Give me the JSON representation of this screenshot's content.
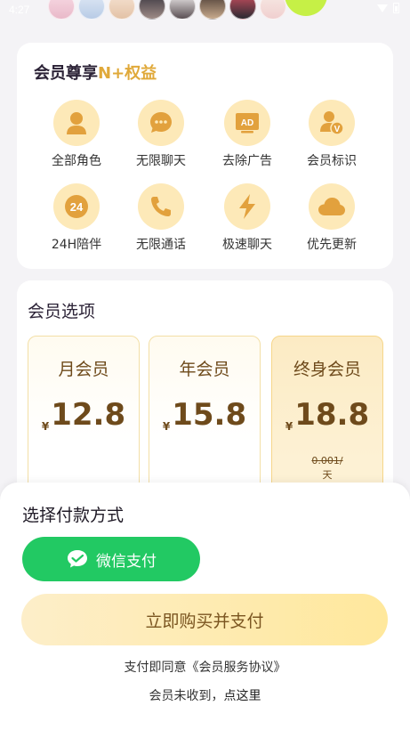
{
  "status_bar": {
    "time": "4:27",
    "icons": [
      "wifi-icon",
      "battery-icon"
    ]
  },
  "benefits": {
    "title_main": "会员尊享",
    "title_accent": "N+权益",
    "accent_color": "#e0a93a",
    "items": [
      {
        "label": "全部角色",
        "icon": "person-icon"
      },
      {
        "label": "无限聊天",
        "icon": "chat-bubble-icon"
      },
      {
        "label": "去除广告",
        "icon": "ad-icon",
        "icon_text": "AD"
      },
      {
        "label": "会员标识",
        "icon": "vip-badge-icon",
        "icon_text": "V"
      },
      {
        "label": "24H陪伴",
        "icon": "24h-icon",
        "icon_text": "24"
      },
      {
        "label": "无限通话",
        "icon": "phone-icon"
      },
      {
        "label": "极速聊天",
        "icon": "lightning-icon"
      },
      {
        "label": "优先更新",
        "icon": "cloud-icon"
      }
    ]
  },
  "options": {
    "title": "会员选项",
    "plans": [
      {
        "name": "月会员",
        "currency": "¥",
        "price": "12.8",
        "selected": false
      },
      {
        "name": "年会员",
        "currency": "¥",
        "price": "15.8",
        "selected": false
      },
      {
        "name": "终身会员",
        "currency": "¥",
        "price": "18.8",
        "selected": true,
        "daily_price": "0.001/",
        "daily_unit": "天"
      }
    ]
  },
  "payment": {
    "title": "选择付款方式",
    "method_label": "微信支付",
    "method_color": "#22c963",
    "buy_label": "立即购买并支付",
    "agreement_text": "支付即同意《会员服务协议》",
    "not_received_text": "会员未收到，",
    "not_received_link": "点这里"
  }
}
